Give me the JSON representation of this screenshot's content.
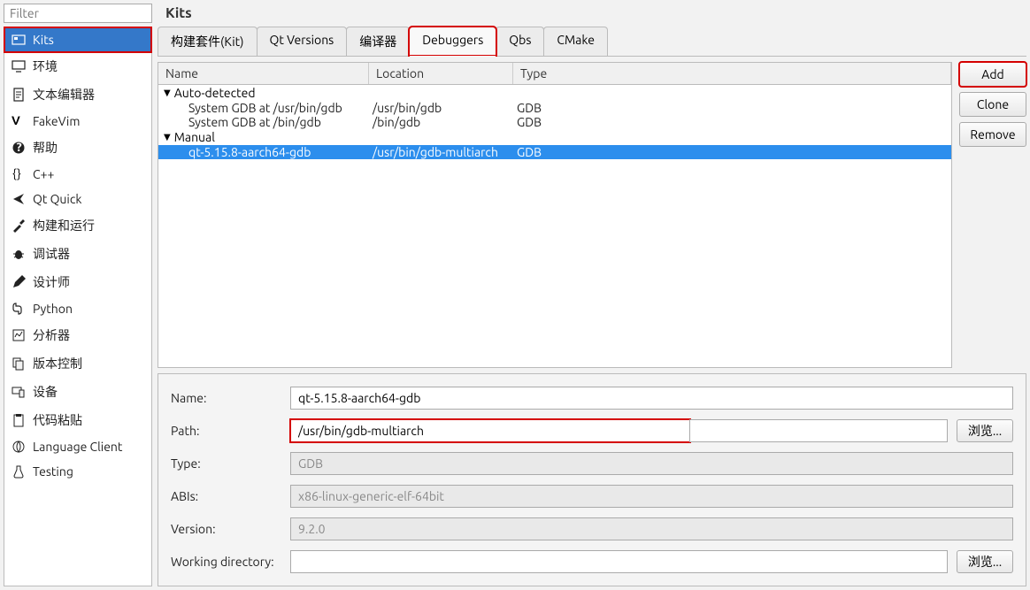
{
  "filter": {
    "placeholder": "Filter"
  },
  "title": "Kits",
  "sidebar": {
    "items": [
      {
        "label": "Kits"
      },
      {
        "label": "环境"
      },
      {
        "label": "文本编辑器"
      },
      {
        "label": "FakeVim"
      },
      {
        "label": "帮助"
      },
      {
        "label": "C++"
      },
      {
        "label": "Qt Quick"
      },
      {
        "label": "构建和运行"
      },
      {
        "label": "调试器"
      },
      {
        "label": "设计师"
      },
      {
        "label": "Python"
      },
      {
        "label": "分析器"
      },
      {
        "label": "版本控制"
      },
      {
        "label": "设备"
      },
      {
        "label": "代码粘贴"
      },
      {
        "label": "Language Client"
      },
      {
        "label": "Testing"
      }
    ]
  },
  "tabs": [
    {
      "label": "构建套件(Kit)"
    },
    {
      "label": "Qt Versions"
    },
    {
      "label": "编译器"
    },
    {
      "label": "Debuggers"
    },
    {
      "label": "Qbs"
    },
    {
      "label": "CMake"
    }
  ],
  "table": {
    "headers": {
      "name": "Name",
      "location": "Location",
      "type": "Type"
    },
    "groups": [
      {
        "label": "Auto-detected",
        "rows": [
          {
            "name": "System GDB at /usr/bin/gdb",
            "location": "/usr/bin/gdb",
            "type": "GDB"
          },
          {
            "name": "System GDB at /bin/gdb",
            "location": "/bin/gdb",
            "type": "GDB"
          }
        ]
      },
      {
        "label": "Manual",
        "rows": [
          {
            "name": "qt-5.15.8-aarch64-gdb",
            "location": "/usr/bin/gdb-multiarch",
            "type": "GDB"
          }
        ]
      }
    ]
  },
  "buttons": {
    "add": "Add",
    "clone": "Clone",
    "remove": "Remove"
  },
  "form": {
    "name_label": "Name:",
    "name_value": "qt-5.15.8-aarch64-gdb",
    "path_label": "Path:",
    "path_value": "/usr/bin/gdb-multiarch",
    "browse": "浏览...",
    "type_label": "Type:",
    "type_value": "GDB",
    "abis_label": "ABIs:",
    "abis_value": "x86-linux-generic-elf-64bit",
    "version_label": "Version:",
    "version_value": "9.2.0",
    "wd_label": "Working directory:",
    "wd_value": ""
  }
}
